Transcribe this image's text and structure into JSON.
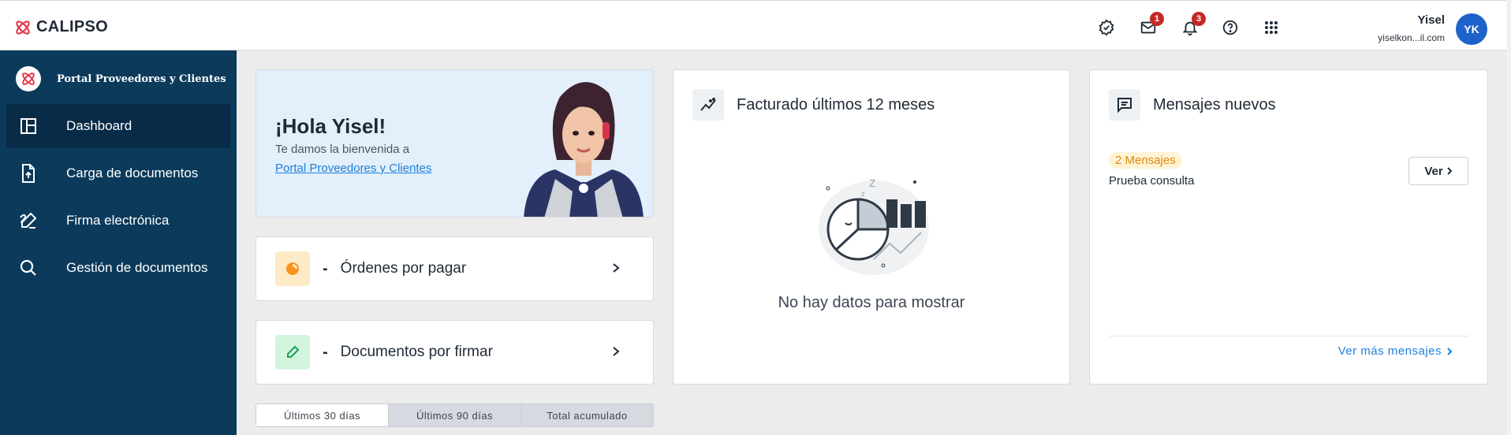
{
  "app": {
    "brand": "CALIPSO"
  },
  "topbar": {
    "icons": [
      "verified-badge-icon",
      "mail-icon",
      "bell-icon",
      "help-icon",
      "apps-grid-icon"
    ],
    "mail_count": "1",
    "notifications_count": "3",
    "user_name": "Yisel",
    "user_email": "yiselkon...il.com",
    "avatar_initials": "YK"
  },
  "sidebar": {
    "portal_name": "Portal Proveedores y Clientes",
    "items": [
      {
        "label": "Dashboard",
        "icon": "dashboard-icon",
        "active": true
      },
      {
        "label": "Carga de documentos",
        "icon": "file-upload-icon",
        "active": false
      },
      {
        "label": "Firma electrónica",
        "icon": "signature-pen-icon",
        "active": false
      },
      {
        "label": "Gestión de documentos",
        "icon": "search-icon",
        "active": false
      }
    ]
  },
  "welcome": {
    "greeting": "¡Hola Yisel!",
    "subtitle": "Te damos la bienvenida a",
    "link_text": "Portal Proveedores y Clientes"
  },
  "actions": [
    {
      "value": "-",
      "label": "Órdenes por pagar",
      "icon": "pie-chart-icon",
      "accent": "#f7941d",
      "bg": "#fdebc8"
    },
    {
      "value": "-",
      "label": "Documentos por firmar",
      "icon": "pencil-icon",
      "accent": "#1f9d55",
      "bg": "#d3f5e0"
    }
  ],
  "tabs": [
    "Últimos 30 días",
    "Últimos 90 días",
    "Total acumulado"
  ],
  "billing": {
    "title": "Facturado últimos 12 meses",
    "empty_text": "No hay datos para mostrar"
  },
  "messages": {
    "title": "Mensajes nuevos",
    "count_label": "2 Mensajes",
    "latest_subject": "Prueba consulta",
    "view_button": "Ver",
    "more_link": "Ver más mensajes"
  },
  "colors": {
    "sidebar": "#0c3a5b",
    "active_nav": "#082b47",
    "brand_red": "#e23b4e",
    "link": "#1e7fd8",
    "avatar": "#1e63c9"
  }
}
